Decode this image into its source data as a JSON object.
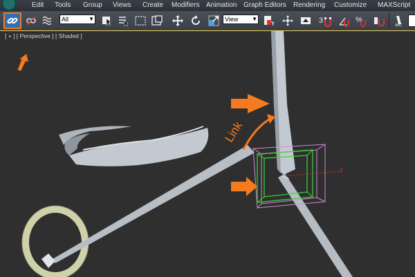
{
  "menu": [
    "Edit",
    "Tools",
    "Group",
    "Views",
    "Create",
    "Modifiers",
    "Animation",
    "Graph Editors",
    "Rendering",
    "Customize",
    "MAXScript"
  ],
  "toolbar": {
    "selection_filter": "All",
    "reference_coord": "View",
    "snap_3d_label": "3",
    "icons": [
      "select-and-link-icon",
      "unlink-selection-icon",
      "bind-to-space-warp-icon",
      "select-object-icon",
      "select-by-name-icon",
      "rectangular-selection-region-icon",
      "window-crossing-icon",
      "select-and-move-icon",
      "select-and-rotate-icon",
      "select-and-scale-icon",
      "mirror-icon",
      "use-pivot-point-center-icon",
      "select-and-manipulate-icon",
      "keyboard-shortcut-override-icon",
      "snaps-toggle-icon",
      "angle-snap-icon",
      "percent-snap-icon",
      "spinner-snap-icon",
      "edit-named-selection-icon"
    ]
  },
  "viewport": {
    "label": "[ + ] [ Perspective ] [ Shaded ]",
    "annotation": "Link",
    "gizmo_axis_label": "y",
    "colors": {
      "arrow": "#f47b20",
      "gizmo_green": "#33dd33",
      "gizmo_magenta": "#d38ad3",
      "object": "#c3c9d1",
      "torus": "#cfd1a8"
    }
  }
}
